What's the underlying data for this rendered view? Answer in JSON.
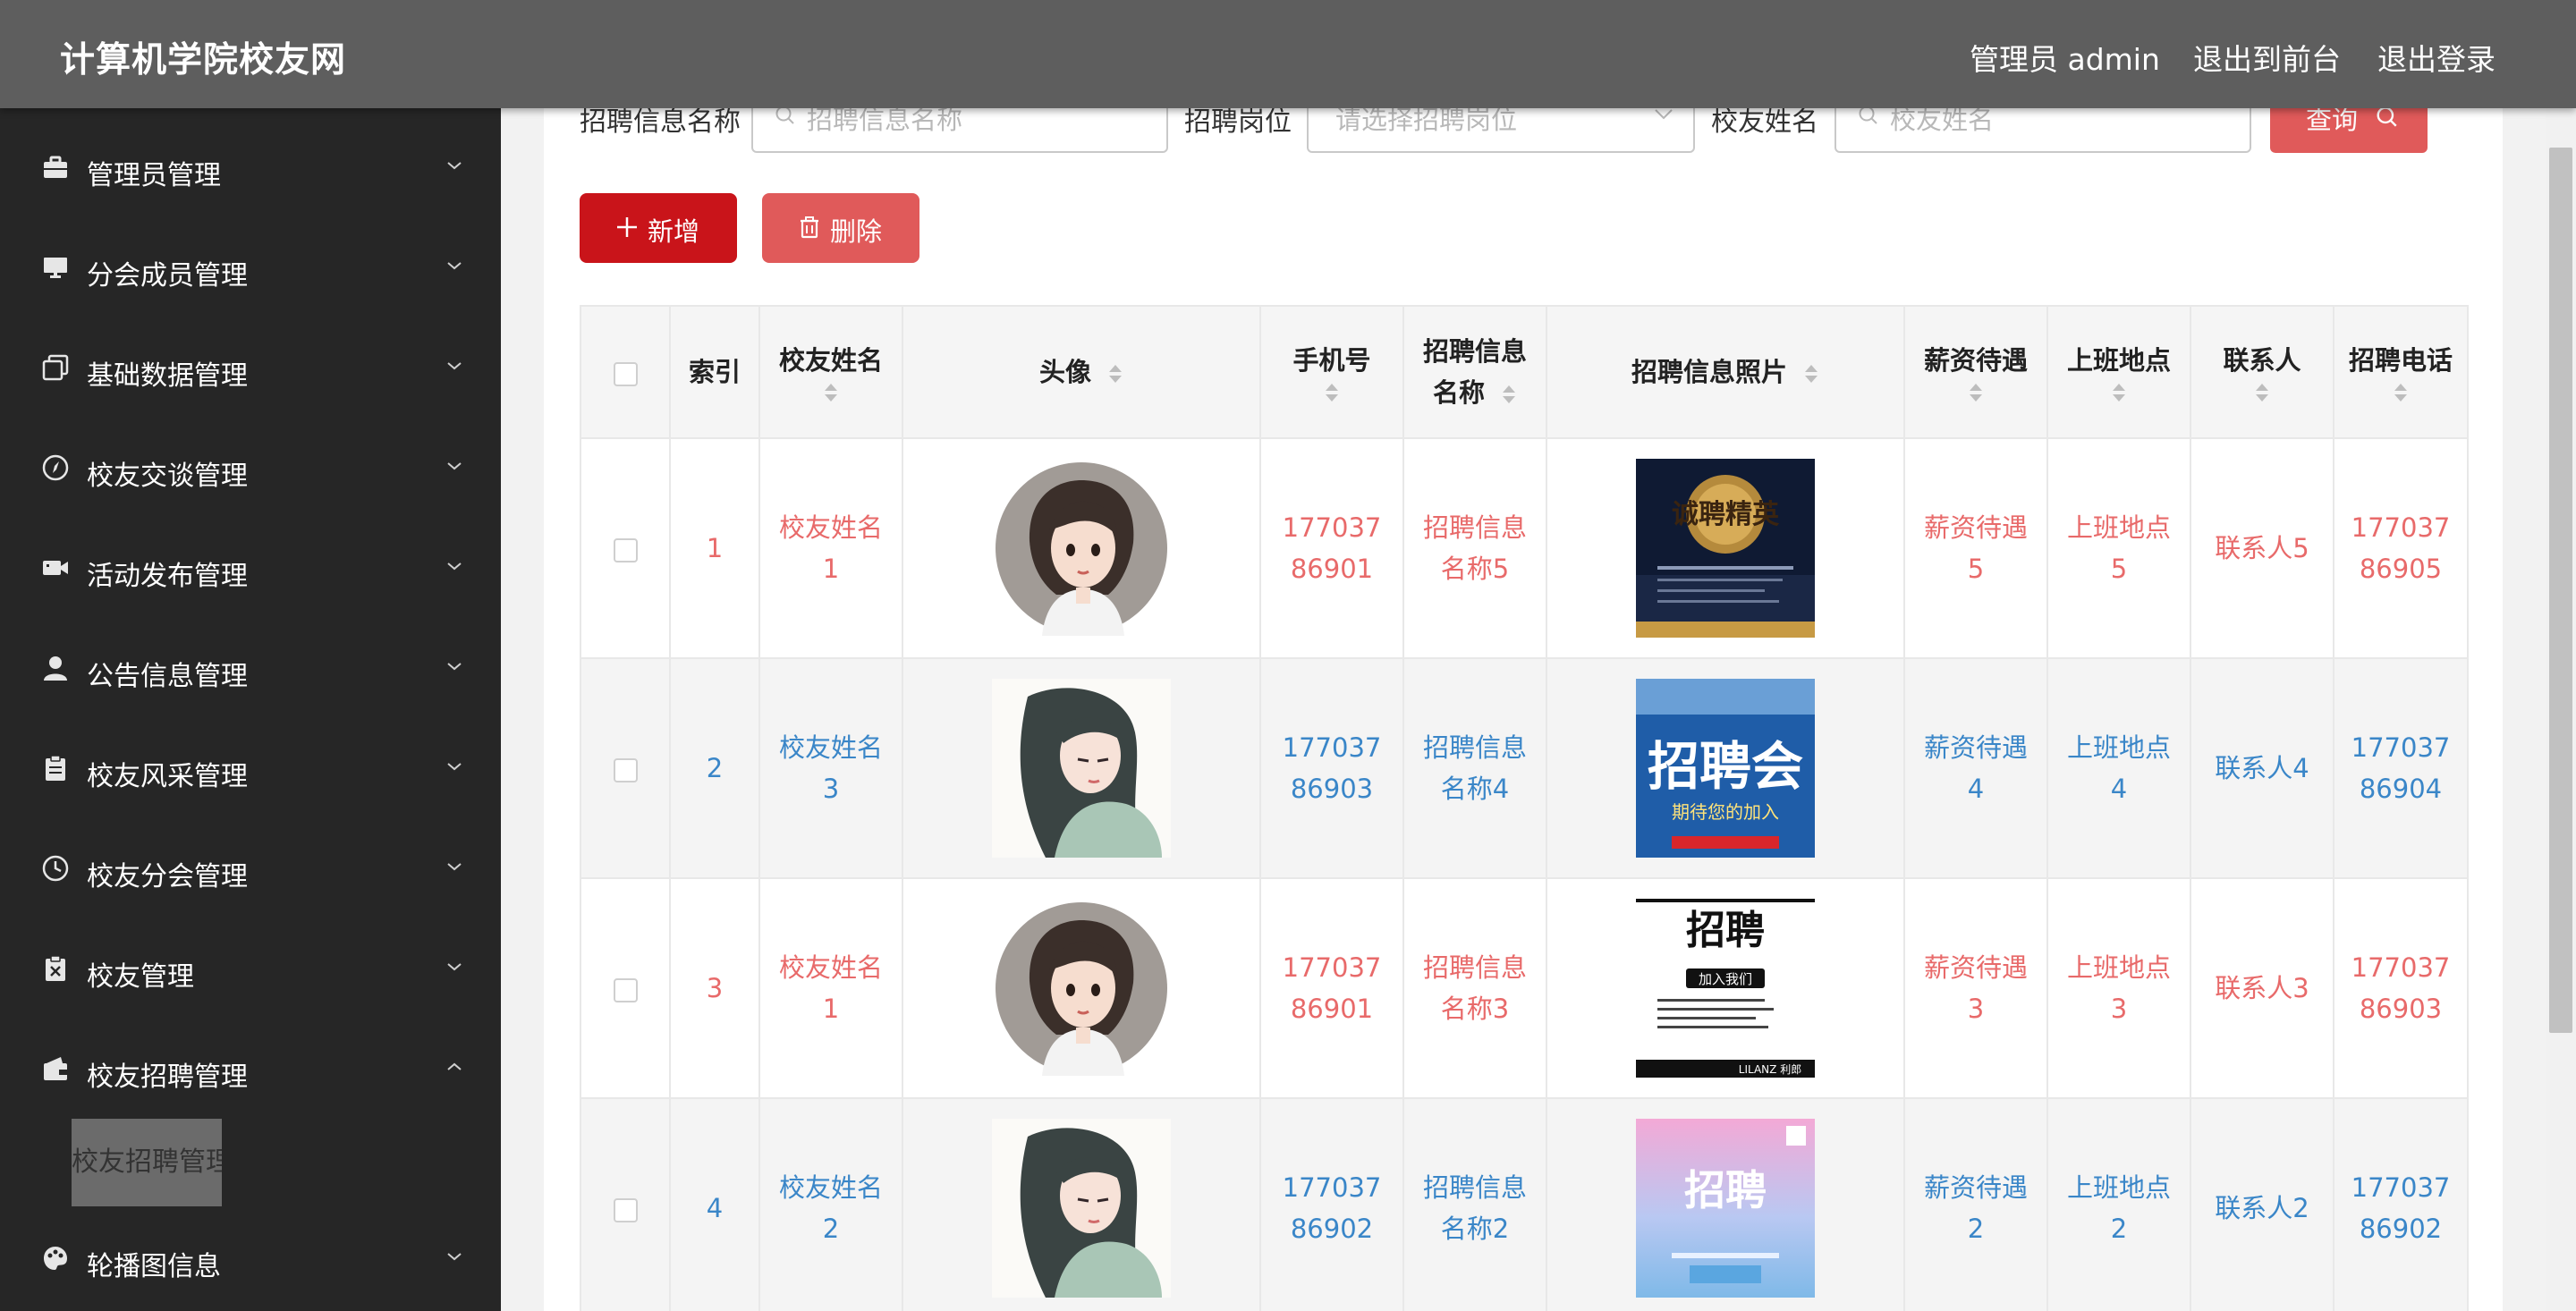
{
  "header": {
    "site_title": "计算机学院校友网",
    "admin_label": "管理员 admin",
    "to_front_label": "退出到前台",
    "logout_label": "退出登录"
  },
  "sidebar": {
    "items": [
      {
        "label": "管理员管理",
        "icon": "briefcase-icon"
      },
      {
        "label": "分会成员管理",
        "icon": "monitor-icon"
      },
      {
        "label": "基础数据管理",
        "icon": "copy-icon"
      },
      {
        "label": "校友交谈管理",
        "icon": "compass-icon"
      },
      {
        "label": "活动发布管理",
        "icon": "video-camera-icon"
      },
      {
        "label": "公告信息管理",
        "icon": "user-icon"
      },
      {
        "label": "校友风采管理",
        "icon": "clipboard-icon"
      },
      {
        "label": "校友分会管理",
        "icon": "clock-icon"
      },
      {
        "label": "校友管理",
        "icon": "clipboard-x-icon"
      },
      {
        "label": "校友招聘管理",
        "icon": "wallet-icon"
      },
      {
        "label": "轮播图信息",
        "icon": "palette-icon"
      }
    ],
    "submenu": {
      "label": "校友招聘管理"
    }
  },
  "search": {
    "name_label": "招聘信息名称",
    "name_placeholder": "招聘信息名称",
    "position_label": "招聘岗位",
    "position_placeholder": "请选择招聘岗位",
    "alumni_label": "校友姓名",
    "alumni_placeholder": "校友姓名",
    "query_label": "查询"
  },
  "actions": {
    "add_label": "新增",
    "delete_label": "删除"
  },
  "table": {
    "headers": {
      "index": "索引",
      "alumni_name": "校友姓名",
      "avatar": "头像",
      "phone": "手机号",
      "recruit_name": "招聘信息名称",
      "recruit_photo": "招聘信息照片",
      "salary": "薪资待遇",
      "location": "上班地点",
      "contact": "联系人",
      "recruit_phone": "招聘电话"
    },
    "rows": [
      {
        "index": "1",
        "alumni_name": "校友姓名1",
        "phone": "17703786901",
        "recruit_name": "招聘信息名称5",
        "poster_text": "诚聘精英",
        "salary": "薪资待遇5",
        "location": "上班地点5",
        "contact": "联系人5",
        "recruit_phone": "17703786905"
      },
      {
        "index": "2",
        "alumni_name": "校友姓名3",
        "phone": "17703786903",
        "recruit_name": "招聘信息名称4",
        "poster_text": "招聘会",
        "poster_sub": "期待您的加入",
        "salary": "薪资待遇4",
        "location": "上班地点4",
        "contact": "联系人4",
        "recruit_phone": "17703786904"
      },
      {
        "index": "3",
        "alumni_name": "校友姓名1",
        "phone": "17703786901",
        "recruit_name": "招聘信息名称3",
        "poster_text": "招聘",
        "poster_sub": "加入我们",
        "poster_brand": "LILANZ 利郎",
        "salary": "薪资待遇3",
        "location": "上班地点3",
        "contact": "联系人3",
        "recruit_phone": "17703786903"
      },
      {
        "index": "4",
        "alumni_name": "校友姓名2",
        "phone": "17703786902",
        "recruit_name": "招聘信息名称2",
        "poster_text": "招聘",
        "salary": "薪资待遇2",
        "location": "上班地点2",
        "contact": "联系人2",
        "recruit_phone": "17703786902"
      }
    ]
  },
  "colors": {
    "header_bg": "#5e5e5e",
    "sidebar_bg": "#262626",
    "primary_red": "#c9141a",
    "light_red": "#e05a5a",
    "odd_row_text": "#e86a6a",
    "even_row_text": "#3a86c8"
  }
}
